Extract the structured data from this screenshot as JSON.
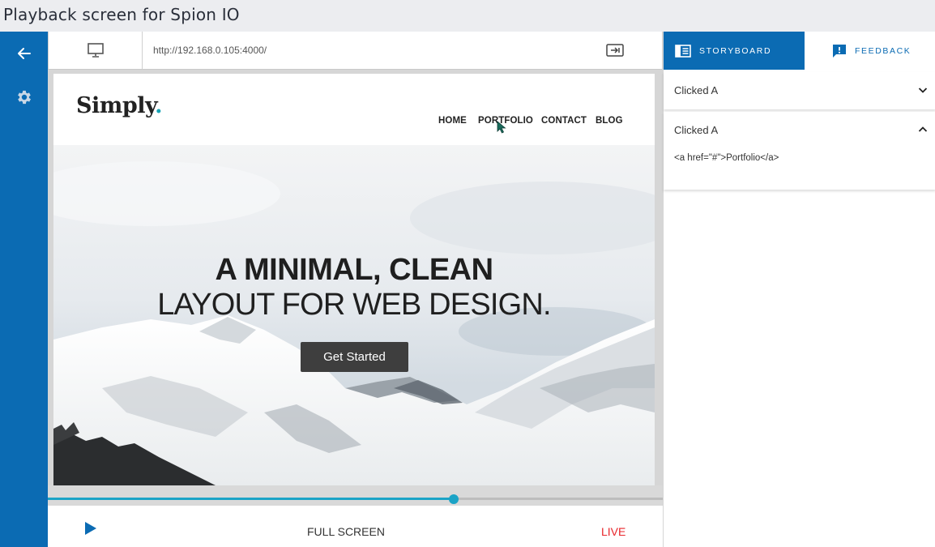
{
  "caption": "Playback screen for Spion IO",
  "sidebar": {
    "back_icon": "arrow-left-icon",
    "settings_icon": "gear-icon"
  },
  "toolbar": {
    "device_icon": "desktop-monitor-icon",
    "url": "http://192.168.0.105:4000/",
    "open_icon": "external-open-icon"
  },
  "site": {
    "logo": "Simply",
    "logo_dot": ".",
    "nav": [
      "HOME",
      "PORTFOLIO",
      "CONTACT",
      "BLOG"
    ],
    "hero_line1": "A MINIMAL, CLEAN",
    "hero_line2": "LAYOUT FOR WEB DESIGN.",
    "cta": "Get Started"
  },
  "playback": {
    "progress": 0.66,
    "fullscreen_label": "FULL SCREEN",
    "live_label": "LIVE"
  },
  "panel": {
    "tabs": [
      {
        "label": "STORYBOARD",
        "icon": "storyboard-icon",
        "active": true
      },
      {
        "label": "FEEDBACK",
        "icon": "feedback-icon",
        "active": false
      }
    ],
    "items": [
      {
        "title": "Clicked A",
        "expanded": false
      },
      {
        "title": "Clicked A",
        "expanded": true,
        "detail": "<a href=\"#\">Portfolio</a>"
      }
    ]
  },
  "colors": {
    "primary_blue": "#0b6bb3",
    "accent_teal": "#1ba3c6",
    "live_red": "#e8262b"
  }
}
